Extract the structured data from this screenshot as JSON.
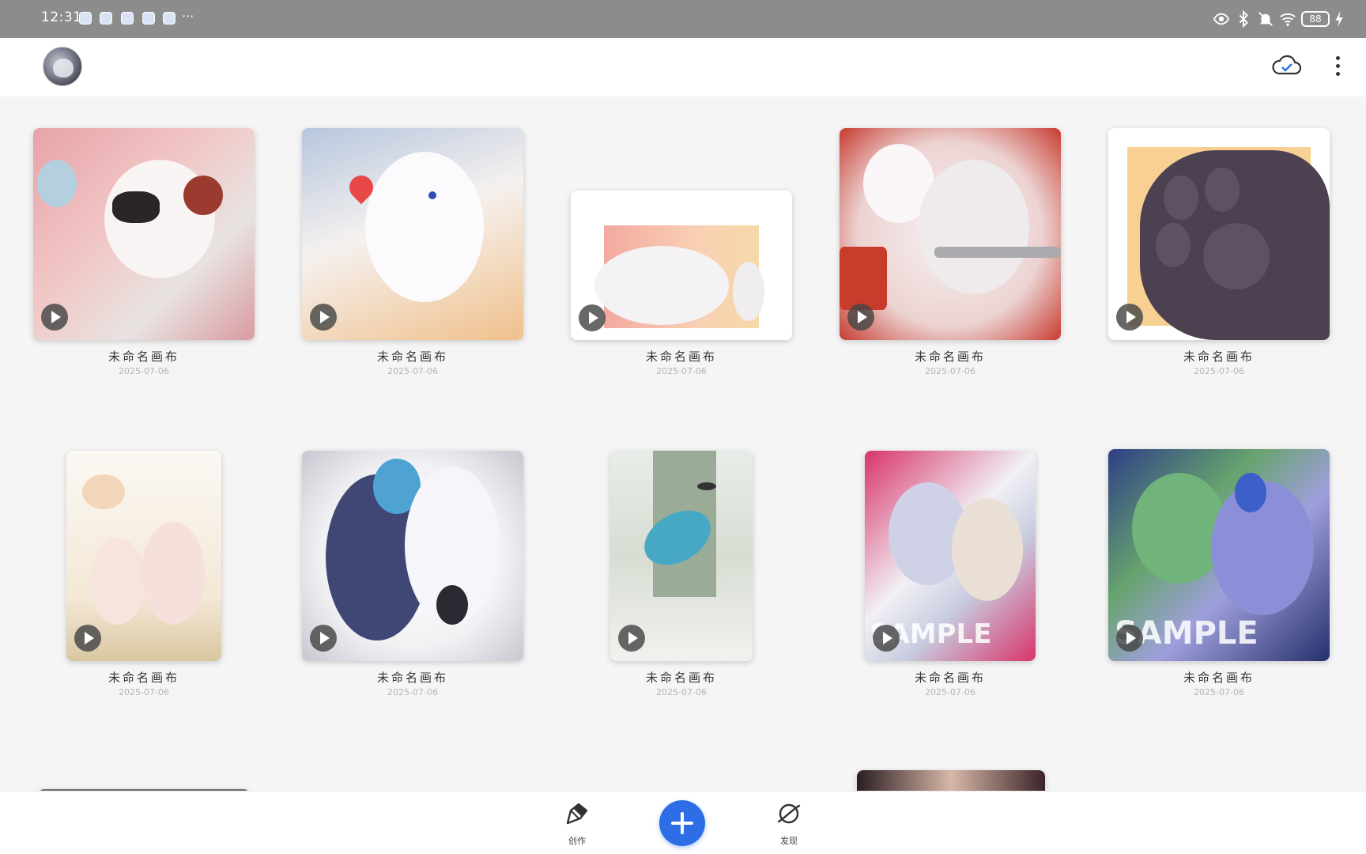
{
  "status_bar": {
    "time": "12:31",
    "more": "···",
    "battery": "88"
  },
  "app_bar": {
    "avatar_icon": "user-avatar",
    "cloud_icon": "cloud-sync-check-icon",
    "menu_icon": "more-vertical-icon"
  },
  "gallery": {
    "items": [
      {
        "title": "未命名画布",
        "date": "2025-07-06"
      },
      {
        "title": "未命名画布",
        "date": "2025-07-06"
      },
      {
        "title": "未命名画布",
        "date": "2025-07-06"
      },
      {
        "title": "未命名画布",
        "date": "2025-07-06"
      },
      {
        "title": "未命名画布",
        "date": "2025-07-06"
      },
      {
        "title": "未命名画布",
        "date": "2025-07-06"
      },
      {
        "title": "未命名画布",
        "date": "2025-07-06"
      },
      {
        "title": "未命名画布",
        "date": "2025-07-06"
      },
      {
        "title": "未命名画布",
        "date": "2025-07-06"
      },
      {
        "title": "未命名画布",
        "date": "2025-07-06"
      }
    ],
    "watermark": "SAMPLE",
    "play_icon": "play-icon"
  },
  "bottom_nav": {
    "create_label": "创作",
    "discover_label": "发现",
    "add_icon": "plus-icon",
    "accent": "#2d6ee6"
  }
}
